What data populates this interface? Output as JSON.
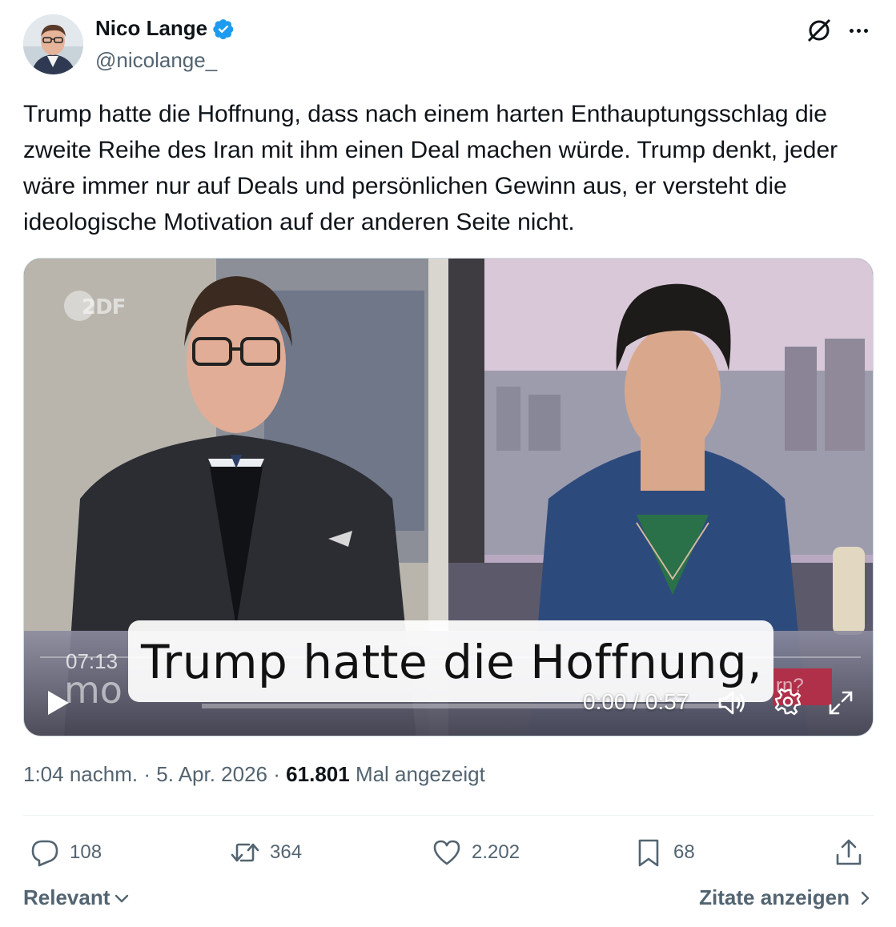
{
  "author": {
    "display_name": "Nico Lange",
    "handle": "@nicolange_",
    "avatar_icon": "avatar",
    "verified_icon": "verified-badge-icon",
    "verified_color": "#1d9bf0"
  },
  "tweet": {
    "text": "Trump hatte die Hoffnung, dass nach einem harten Enthauptungsschlag die zweite Reihe des Iran mit ihm einen Deal machen würde. Trump denkt, jeder wäre immer nur auf Deals und persönlichen Gewinn aus, er versteht die ideologische Motivation auf der anderen Seite nicht."
  },
  "video": {
    "channel_logo": "2DF",
    "clock": "07:13",
    "show_name": "mo",
    "subtitle": "Trump hatte die Hoffnung,",
    "tag_text": "rn?",
    "time": "0:00 / 0:57",
    "progress": 0
  },
  "meta": {
    "time": "1:04 nachm.",
    "separator1": "·",
    "date": "5. Apr. 2026",
    "separator2": "·",
    "views": "61.801",
    "views_label": "Mal angezeigt"
  },
  "actions": {
    "replies": "108",
    "reposts": "364",
    "likes": "2.202",
    "bookmarks": "68"
  },
  "footer": {
    "sort_label": "Relevant",
    "quotes_label": "Zitate anzeigen"
  },
  "colors": {
    "text_primary": "#0f1419",
    "text_secondary": "#536471",
    "accent": "#1d9bf0"
  }
}
